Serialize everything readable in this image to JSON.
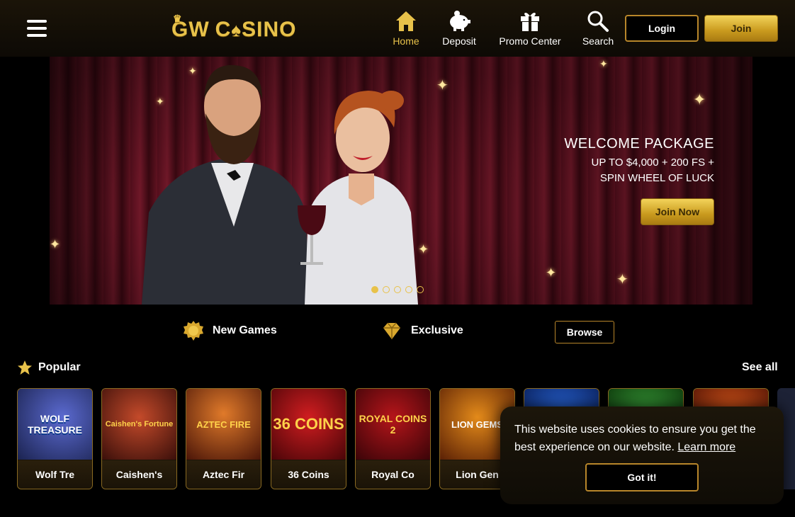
{
  "header": {
    "logo_text_prefix": "GW",
    "logo_text_c": "C",
    "logo_text_suffix": "SINO",
    "nav": [
      {
        "label": "Home",
        "icon": "home-icon",
        "active": true
      },
      {
        "label": "Deposit",
        "icon": "piggy-bank-icon"
      },
      {
        "label": "Promo Center",
        "icon": "gift-icon"
      },
      {
        "label": "Search",
        "icon": "search-icon"
      }
    ],
    "login_label": "Login",
    "join_label": "Join"
  },
  "hero": {
    "title": "WELCOME PACKAGE",
    "line1": "UP TO $4,000 + 200 FS +",
    "line2": "SPIN WHEEL OF LUCK",
    "cta_label": "Join Now",
    "slides": 5,
    "active_slide": 1
  },
  "categories": {
    "new_games": "New Games",
    "exclusive": "Exclusive",
    "browse": "Browse"
  },
  "popular": {
    "label": "Popular",
    "see_all": "See all",
    "games": [
      {
        "name": "Wolf Tre",
        "art": "WOLF TREASURE"
      },
      {
        "name": "Caishen's",
        "art": "Caishen's Fortune"
      },
      {
        "name": "Aztec Fir",
        "art": "AZTEC FIRE"
      },
      {
        "name": "36 Coins",
        "art": "36 COINS"
      },
      {
        "name": "Royal Co",
        "art": "ROYAL COINS 2"
      },
      {
        "name": "Lion Gen",
        "art": "LION GEMS"
      },
      {
        "name": "",
        "art": ""
      },
      {
        "name": "",
        "art": ""
      },
      {
        "name": "",
        "art": ""
      }
    ]
  },
  "cookie": {
    "text": "This website uses cookies to ensure you get the best experience on our website.",
    "learn_more": "Learn more",
    "button": "Got it!"
  },
  "colors": {
    "gold": "#e8c24a",
    "border_gold": "#b8862a",
    "curtain": "#7a1a2c"
  }
}
